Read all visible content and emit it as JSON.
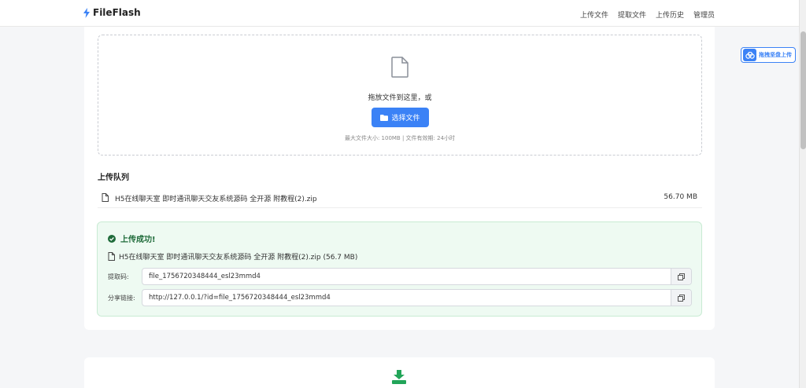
{
  "brand": {
    "name": "FileFlash",
    "icon": "bolt-icon"
  },
  "nav": {
    "items": [
      {
        "label": "上传文件"
      },
      {
        "label": "提取文件"
      },
      {
        "label": "上传历史"
      },
      {
        "label": "管理员"
      }
    ]
  },
  "upload": {
    "drop_text": "拖放文件到这里，或",
    "choose_label": "选择文件",
    "limit_text": "最大文件大小: 100MB | 文件有效期: 24小时"
  },
  "queue": {
    "title": "上传队列",
    "items": [
      {
        "name": "H5在线聊天室 即时通讯聊天交友系统源码 全开源 附教程(2).zip",
        "size": "56.70 MB"
      }
    ]
  },
  "result": {
    "title": "上传成功!",
    "file_line": "H5在线聊天室 即时通讯聊天交友系统源码 全开源 附教程(2).zip (56.7 MB)",
    "code_label": "提取码:",
    "code_value": "file_1756720348444_esl23mmd4",
    "link_label": "分享链接:",
    "link_value": "http://127.0.0.1/?id=file_1756720348444_esl23mmd4"
  },
  "float_button": {
    "label": "拖拽坚盘上传",
    "icon": "cloud-upload-icon"
  },
  "colors": {
    "primary": "#3b82f6",
    "success_bg": "#eefaf2",
    "success_text": "#1f6b3a",
    "download_green": "#22a559"
  }
}
